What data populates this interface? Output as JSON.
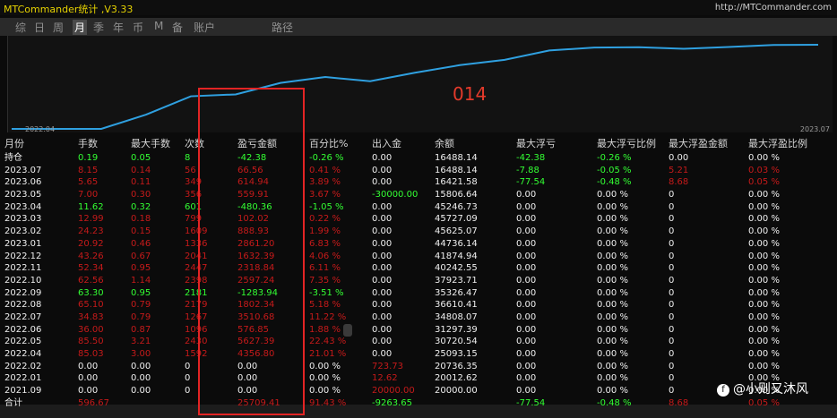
{
  "app": {
    "title": "MTCommander统计 ,V3.33",
    "url": "http://MTCommander.com"
  },
  "tabs": [
    {
      "label": "综"
    },
    {
      "label": "日"
    },
    {
      "label": "周"
    },
    {
      "label": "月",
      "active": true
    },
    {
      "label": "季"
    },
    {
      "label": "年"
    },
    {
      "label": "币"
    },
    {
      "label": "M"
    },
    {
      "label": "备"
    },
    {
      "label": "账户"
    },
    {
      "label": "路径"
    }
  ],
  "chart_data": {
    "type": "line",
    "x_start_label": "2022.04",
    "x_end_label": "2023.07",
    "annotation": "014",
    "series": [
      {
        "x": [
          "2021.09",
          "2022.01",
          "2022.02",
          "2022.04",
          "2022.05",
          "2022.06",
          "2022.07",
          "2022.08",
          "2022.09",
          "2022.10",
          "2022.11",
          "2022.12",
          "2023.01",
          "2023.02",
          "2023.03",
          "2023.04",
          "2023.05",
          "2023.06",
          "2023.07"
        ],
        "values": [
          20000,
          20012.62,
          20736.35,
          25093.15,
          30720.54,
          31297.39,
          34808.07,
          36610.41,
          35326.47,
          37923.71,
          40242.55,
          41874.94,
          44736.14,
          45625.07,
          45727.09,
          45246.73,
          15806.64,
          16421.58,
          16488.14
        ],
        "color": "#2fa0e0"
      }
    ]
  },
  "table": {
    "headers": [
      "月份",
      "手数",
      "最大手数",
      "次数",
      "盈亏金额",
      "百分比%",
      "出入金",
      "余额",
      "最大浮亏",
      "最大浮亏比例",
      "最大浮盈金额",
      "最大浮盈比例"
    ],
    "rows": [
      {
        "c": [
          "持仓",
          "0.19",
          "0.05",
          "8",
          "-42.38",
          "-0.26 %",
          "0.00",
          "16488.14",
          "-42.38",
          "-0.26 %",
          "0.00",
          "0.00 %"
        ],
        "k": [
          "w",
          "g",
          "g",
          "g",
          "g",
          "g",
          "w",
          "w",
          "g",
          "g",
          "w",
          "w"
        ]
      },
      {
        "c": [
          "2023.07",
          "8.15",
          "0.14",
          "56",
          "66.56",
          "0.41 %",
          "0.00",
          "16488.14",
          "-7.88",
          "-0.05 %",
          "5.21",
          "0.03 %"
        ],
        "k": [
          "w",
          "r",
          "r",
          "r",
          "r",
          "r",
          "w",
          "w",
          "g",
          "g",
          "r",
          "r"
        ]
      },
      {
        "c": [
          "2023.06",
          "5.65",
          "0.11",
          "349",
          "614.94",
          "3.89 %",
          "0.00",
          "16421.58",
          "-77.54",
          "-0.48 %",
          "8.68",
          "0.05 %"
        ],
        "k": [
          "w",
          "r",
          "r",
          "r",
          "r",
          "r",
          "w",
          "w",
          "g",
          "g",
          "r",
          "r"
        ]
      },
      {
        "c": [
          "2023.05",
          "7.00",
          "0.30",
          "356",
          "559.91",
          "3.67 %",
          "-30000.00",
          "15806.64",
          "0.00",
          "0.00 %",
          "0",
          "0.00 %"
        ],
        "k": [
          "w",
          "r",
          "r",
          "r",
          "r",
          "r",
          "g",
          "w",
          "w",
          "w",
          "w",
          "w"
        ]
      },
      {
        "c": [
          "2023.04",
          "11.62",
          "0.32",
          "601",
          "-480.36",
          "-1.05 %",
          "0.00",
          "45246.73",
          "0.00",
          "0.00 %",
          "0",
          "0.00 %"
        ],
        "k": [
          "w",
          "g",
          "g",
          "g",
          "g",
          "g",
          "w",
          "w",
          "w",
          "w",
          "w",
          "w"
        ]
      },
      {
        "c": [
          "2023.03",
          "12.99",
          "0.18",
          "799",
          "102.02",
          "0.22 %",
          "0.00",
          "45727.09",
          "0.00",
          "0.00 %",
          "0",
          "0.00 %"
        ],
        "k": [
          "w",
          "r",
          "r",
          "r",
          "r",
          "r",
          "w",
          "w",
          "w",
          "w",
          "w",
          "w"
        ]
      },
      {
        "c": [
          "2023.02",
          "24.23",
          "0.15",
          "1609",
          "888.93",
          "1.99 %",
          "0.00",
          "45625.07",
          "0.00",
          "0.00 %",
          "0",
          "0.00 %"
        ],
        "k": [
          "w",
          "r",
          "r",
          "r",
          "r",
          "r",
          "w",
          "w",
          "w",
          "w",
          "w",
          "w"
        ]
      },
      {
        "c": [
          "2023.01",
          "20.92",
          "0.46",
          "1336",
          "2861.20",
          "6.83 %",
          "0.00",
          "44736.14",
          "0.00",
          "0.00 %",
          "0",
          "0.00 %"
        ],
        "k": [
          "w",
          "r",
          "r",
          "r",
          "r",
          "r",
          "w",
          "w",
          "w",
          "w",
          "w",
          "w"
        ]
      },
      {
        "c": [
          "2022.12",
          "43.26",
          "0.67",
          "2041",
          "1632.39",
          "4.06 %",
          "0.00",
          "41874.94",
          "0.00",
          "0.00 %",
          "0",
          "0.00 %"
        ],
        "k": [
          "w",
          "r",
          "r",
          "r",
          "r",
          "r",
          "w",
          "w",
          "w",
          "w",
          "w",
          "w"
        ]
      },
      {
        "c": [
          "2022.11",
          "52.34",
          "0.95",
          "2447",
          "2318.84",
          "6.11 %",
          "0.00",
          "40242.55",
          "0.00",
          "0.00 %",
          "0",
          "0.00 %"
        ],
        "k": [
          "w",
          "r",
          "r",
          "r",
          "r",
          "r",
          "w",
          "w",
          "w",
          "w",
          "w",
          "w"
        ]
      },
      {
        "c": [
          "2022.10",
          "62.56",
          "1.14",
          "2398",
          "2597.24",
          "7.35 %",
          "0.00",
          "37923.71",
          "0.00",
          "0.00 %",
          "0",
          "0.00 %"
        ],
        "k": [
          "w",
          "r",
          "r",
          "r",
          "r",
          "r",
          "w",
          "w",
          "w",
          "w",
          "w",
          "w"
        ]
      },
      {
        "c": [
          "2022.09",
          "63.30",
          "0.95",
          "2181",
          "-1283.94",
          "-3.51 %",
          "0.00",
          "35326.47",
          "0.00",
          "0.00 %",
          "0",
          "0.00 %"
        ],
        "k": [
          "w",
          "g",
          "g",
          "g",
          "g",
          "g",
          "w",
          "w",
          "w",
          "w",
          "w",
          "w"
        ]
      },
      {
        "c": [
          "2022.08",
          "65.10",
          "0.79",
          "2179",
          "1802.34",
          "5.18 %",
          "0.00",
          "36610.41",
          "0.00",
          "0.00 %",
          "0",
          "0.00 %"
        ],
        "k": [
          "w",
          "r",
          "r",
          "r",
          "r",
          "r",
          "w",
          "w",
          "w",
          "w",
          "w",
          "w"
        ]
      },
      {
        "c": [
          "2022.07",
          "34.83",
          "0.79",
          "1267",
          "3510.68",
          "11.22 %",
          "0.00",
          "34808.07",
          "0.00",
          "0.00 %",
          "0",
          "0.00 %"
        ],
        "k": [
          "w",
          "r",
          "r",
          "r",
          "r",
          "r",
          "w",
          "w",
          "w",
          "w",
          "w",
          "w"
        ]
      },
      {
        "c": [
          "2022.06",
          "36.00",
          "0.87",
          "1096",
          "576.85",
          "1.88 %",
          "0.00",
          "31297.39",
          "0.00",
          "0.00 %",
          "0",
          "0.00 %"
        ],
        "k": [
          "w",
          "r",
          "r",
          "r",
          "r",
          "r",
          "w",
          "w",
          "w",
          "w",
          "w",
          "w"
        ]
      },
      {
        "c": [
          "2022.05",
          "85.50",
          "3.21",
          "2430",
          "5627.39",
          "22.43 %",
          "0.00",
          "30720.54",
          "0.00",
          "0.00 %",
          "0",
          "0.00 %"
        ],
        "k": [
          "w",
          "r",
          "r",
          "r",
          "r",
          "r",
          "w",
          "w",
          "w",
          "w",
          "w",
          "w"
        ]
      },
      {
        "c": [
          "2022.04",
          "85.03",
          "3.00",
          "1592",
          "4356.80",
          "21.01 %",
          "0.00",
          "25093.15",
          "0.00",
          "0.00 %",
          "0",
          "0.00 %"
        ],
        "k": [
          "w",
          "r",
          "r",
          "r",
          "r",
          "r",
          "w",
          "w",
          "w",
          "w",
          "w",
          "w"
        ]
      },
      {
        "c": [
          "2022.02",
          "0.00",
          "0.00",
          "0",
          "0.00",
          "0.00 %",
          "723.73",
          "20736.35",
          "0.00",
          "0.00 %",
          "0",
          "0.00 %"
        ],
        "k": [
          "w",
          "w",
          "w",
          "w",
          "w",
          "w",
          "r",
          "w",
          "w",
          "w",
          "w",
          "w"
        ]
      },
      {
        "c": [
          "2022.01",
          "0.00",
          "0.00",
          "0",
          "0.00",
          "0.00 %",
          "12.62",
          "20012.62",
          "0.00",
          "0.00 %",
          "0",
          "0.00 %"
        ],
        "k": [
          "w",
          "w",
          "w",
          "w",
          "w",
          "w",
          "r",
          "w",
          "w",
          "w",
          "w",
          "w"
        ]
      },
      {
        "c": [
          "2021.09",
          "0.00",
          "0.00",
          "0",
          "0.00",
          "0.00 %",
          "20000.00",
          "20000.00",
          "0.00",
          "0.00 %",
          "0",
          "0.00 %"
        ],
        "k": [
          "w",
          "w",
          "w",
          "w",
          "w",
          "w",
          "r",
          "w",
          "w",
          "w",
          "w",
          "w"
        ]
      }
    ],
    "total": {
      "c": [
        "合计",
        "596.67",
        "",
        "",
        "25709.41",
        "91.43 %",
        "-9263.65",
        "",
        "-77.54",
        "-0.48 %",
        "8.68",
        "0.05 %"
      ],
      "k": [
        "w",
        "r",
        "r",
        "r",
        "r",
        "r",
        "g",
        "w",
        "g",
        "g",
        "r",
        "r"
      ]
    }
  },
  "watermark": "@小则又沐风"
}
